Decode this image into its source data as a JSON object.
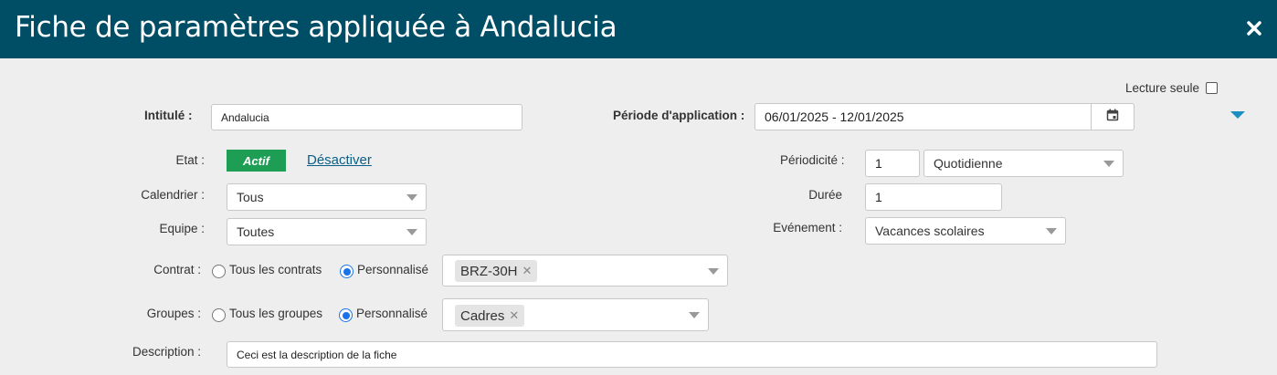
{
  "window": {
    "title": "Fiche de paramètres appliquée à Andalucia",
    "close_icon": "close-icon"
  },
  "form": {
    "readonly_label": "Lecture seule",
    "readonly_checked": false,
    "intitule": {
      "label": "Intitulé :",
      "value": "Andalucia"
    },
    "periode": {
      "label": "Période d'application :",
      "value": "06/01/2025 - 12/01/2025",
      "icon": "calendar-icon"
    },
    "etat": {
      "label": "Etat :",
      "badge": "Actif",
      "badge_color": "#1e9e55",
      "action": "Désactiver"
    },
    "periodicite": {
      "label": "Périodicité :",
      "value": "1",
      "unit": "Quotidienne"
    },
    "calendrier": {
      "label": "Calendrier :",
      "value": "Tous"
    },
    "duree": {
      "label": "Durée",
      "value": "1"
    },
    "equipe": {
      "label": "Equipe :",
      "value": "Toutes"
    },
    "evenement": {
      "label": "Evénement :",
      "value": "Vacances scolaires"
    },
    "contrat": {
      "label": "Contrat :",
      "option_all": "Tous les contrats",
      "option_custom": "Personnalisé",
      "selected": "custom",
      "tags": [
        "BRZ-30H"
      ]
    },
    "groupes": {
      "label": "Groupes :",
      "option_all": "Tous les groupes",
      "option_custom": "Personnalisé",
      "selected": "custom",
      "tags": [
        "Cadres"
      ]
    },
    "description": {
      "label": "Description :",
      "value": "Ceci est la description de la fiche"
    }
  },
  "colors": {
    "header_bg": "#004d66",
    "page_bg": "#eeeeee",
    "accent_link": "#0b5f86",
    "radio_selected": "#1a73e8",
    "collapse_arrow": "#1a8fc0"
  }
}
